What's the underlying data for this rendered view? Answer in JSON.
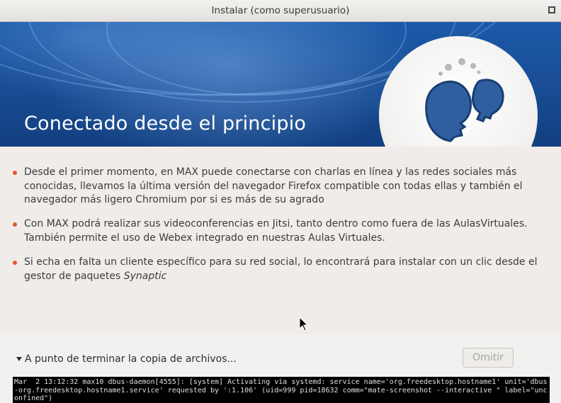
{
  "window": {
    "title": "Instalar (como superusuario)",
    "maximize_icon": "maximize-icon"
  },
  "banner": {
    "heading": "Conectado desde el principio",
    "illustration_icon": "two-heads-chat-icon"
  },
  "bullets": [
    {
      "text": "Desde el primer momento, en MAX puede conectarse con charlas en línea y las redes sociales más conocidas, llevamos la última versión del navegador Firefox compatible con todas ellas y también el navegador más ligero Chromium por si es más de su agrado"
    },
    {
      "text": "Con MAX podrá realizar sus videoconferencias en Jitsi, tanto dentro como fuera de las AulasVirtuales. También permite el uso de Webex integrado en nuestras Aulas Virtuales."
    },
    {
      "text_before": "Si echa en falta un cliente específico para su red social, lo encontrará para instalar con un clic desde el gestor de paquetes ",
      "text_emphasis": "Synaptic"
    }
  ],
  "footer": {
    "progress_label": "A punto de terminar la copia de archivos...",
    "toggle_icon": "triangle-down-icon",
    "skip_label": "Omitir",
    "log_text": "Mar  2 13:12:32 max10 dbus-daemon[4555]: [system] Activating via systemd: service name='org.freedesktop.hostname1' unit='dbus-org.freedesktop.hostname1.service' requested by ':1.106' (uid=999 pid=18632 comm=\"mate-screenshot --interactive \" label=\"unconfined\")"
  },
  "colors": {
    "bullet": "#e2582a",
    "banner": "#1a4f98"
  }
}
